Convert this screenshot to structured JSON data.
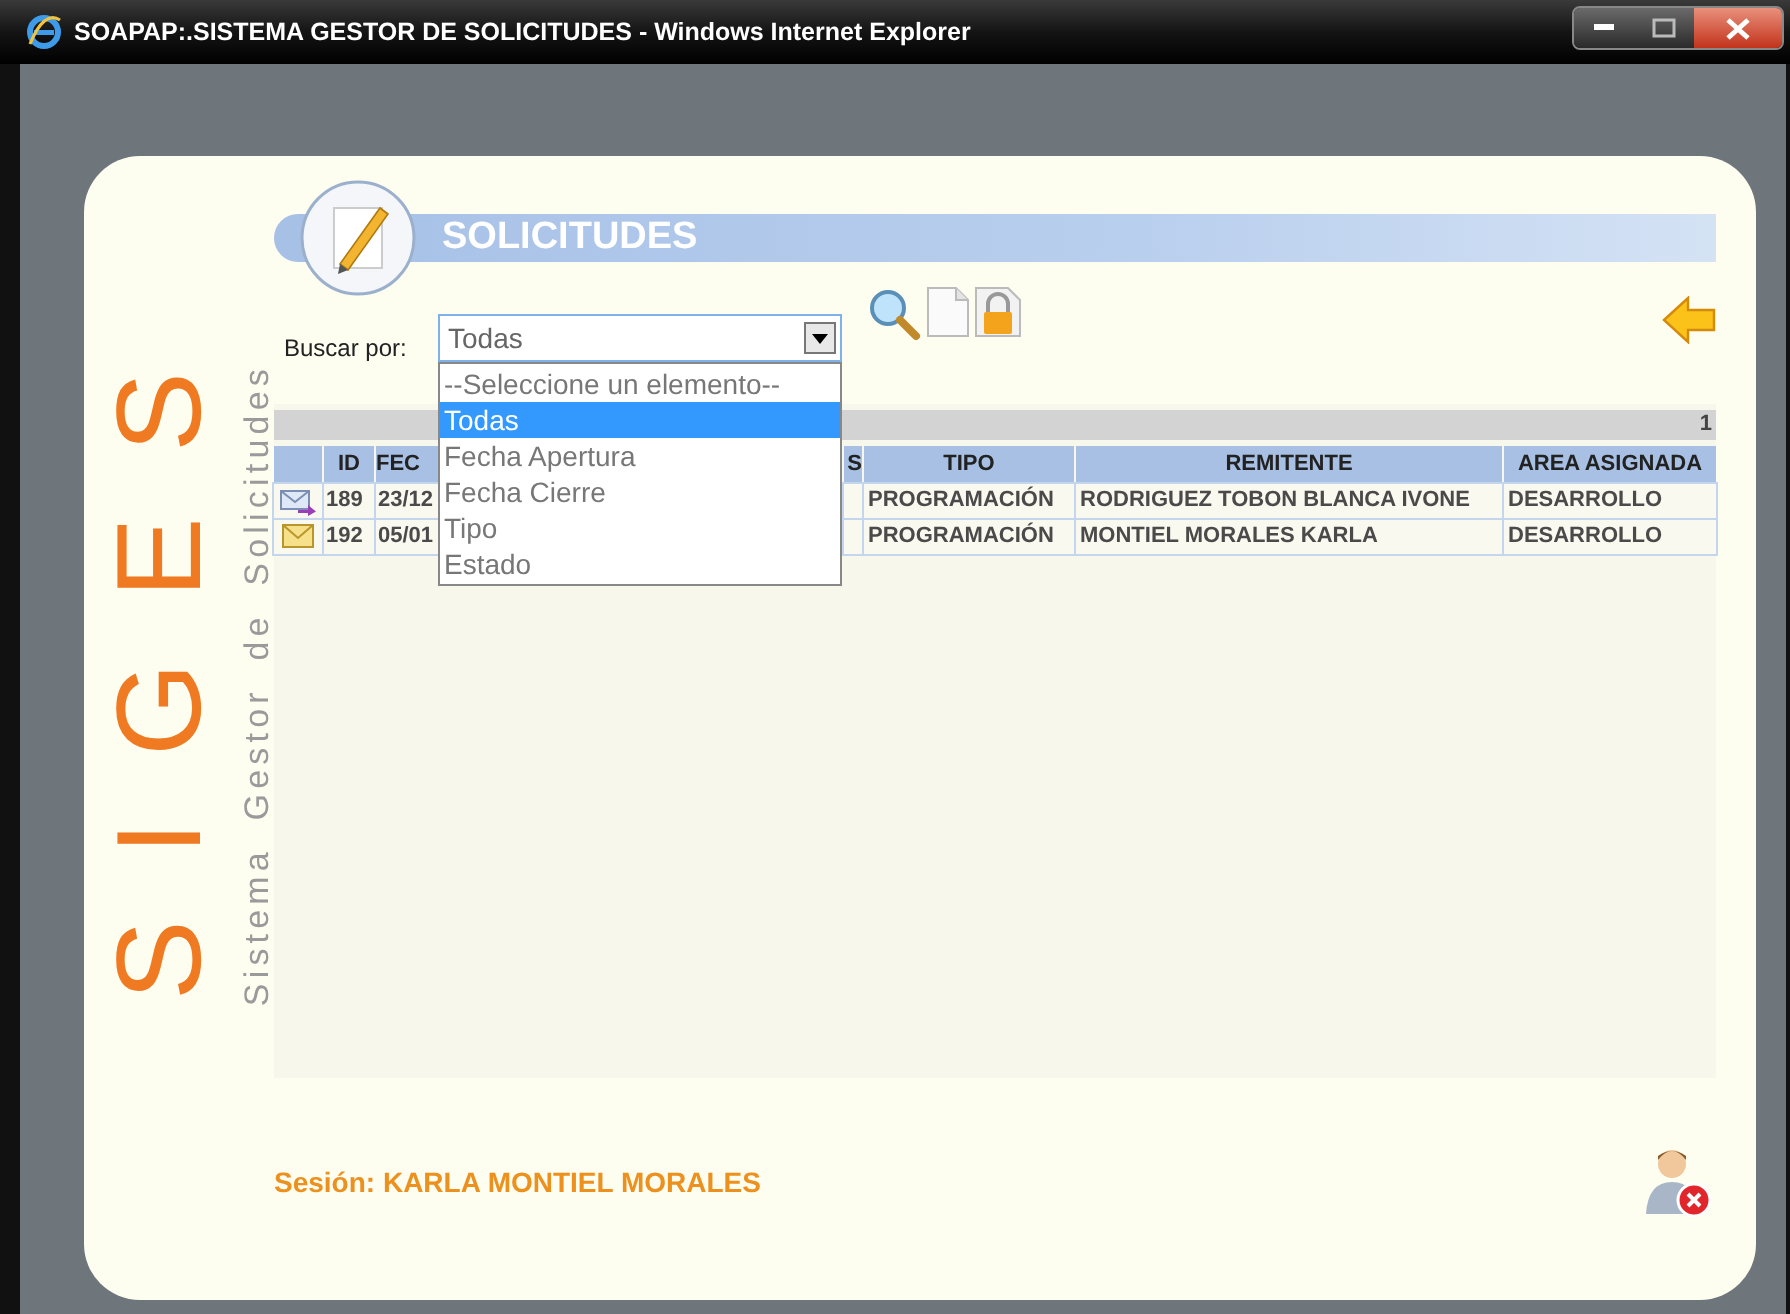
{
  "window": {
    "title": "SOAPAP:.SISTEMA GESTOR DE SOLICITUDES - Windows Internet Explorer"
  },
  "logo": {
    "letters": "S I G E S",
    "subtitle": "Sistema Gestor de Solicitudes"
  },
  "header": {
    "title": "SOLICITUDES"
  },
  "search": {
    "label": "Buscar por:",
    "value": "Todas",
    "expanded": true,
    "options": [
      {
        "label": "--Seleccione un elemento--",
        "selected": false
      },
      {
        "label": "Todas",
        "selected": true
      },
      {
        "label": "Fecha Apertura",
        "selected": false
      },
      {
        "label": "Fecha Cierre",
        "selected": false
      },
      {
        "label": "Tipo",
        "selected": false
      },
      {
        "label": "Estado",
        "selected": false
      }
    ]
  },
  "table": {
    "pager": "1",
    "columns": [
      "ID",
      "FEC",
      "S",
      "TIPO",
      "REMITENTE",
      "AREA ASIGNADA"
    ],
    "rows": [
      {
        "kind": "forwarded",
        "cells": [
          "189",
          "23/12",
          "",
          "PROGRAMACIÓN",
          "RODRIGUEZ TOBON BLANCA IVONE",
          "DESARROLLO"
        ]
      },
      {
        "kind": "mail",
        "cells": [
          "192",
          "05/01",
          "",
          "PROGRAMACIÓN",
          "MONTIEL MORALES KARLA",
          "DESARROLLO"
        ]
      }
    ]
  },
  "session": {
    "text": "Sesión: KARLA MONTIEL MORALES"
  }
}
